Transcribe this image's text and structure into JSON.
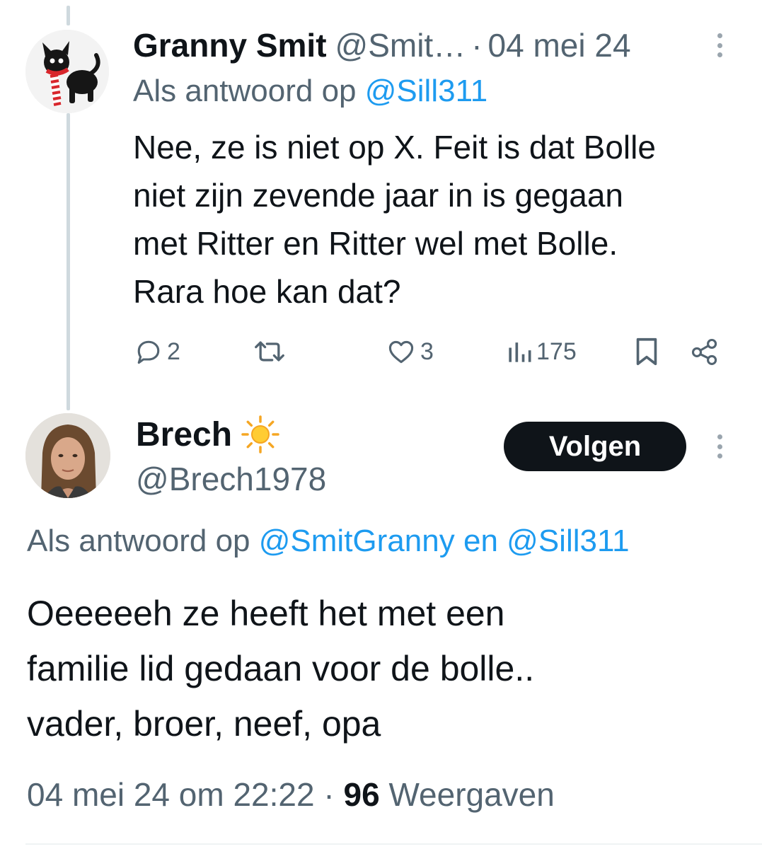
{
  "tweet1": {
    "display_name": "Granny Smit",
    "handle": "@Smit…",
    "separator": "·",
    "date": "04 mei 24",
    "reply_prefix": "Als antwoord op",
    "reply_mention": "@Sill311",
    "body_lines": [
      "Nee, ze is niet op X. Feit is dat Bolle",
      "niet zijn zevende jaar in is gegaan",
      "met Ritter en Ritter wel met Bolle.",
      "Rara hoe kan dat?"
    ],
    "actions": {
      "replies": "2",
      "retweets": "",
      "likes": "3",
      "views": "175"
    },
    "avatar_icon": "black-cat-with-striped-scarf"
  },
  "tweet2": {
    "display_name": "Brech",
    "name_emoji": "sun-icon",
    "handle": "@Brech1978",
    "follow_label": "Volgen",
    "reply_prefix": "Als antwoord op",
    "reply_mention_1": "@SmitGranny",
    "reply_conjunction": "en",
    "reply_mention_2": "@Sill311",
    "body_lines": [
      "Oeeeeeh ze heeft het met een",
      "familie lid gedaan voor de bolle..",
      "vader, broer, neef, opa"
    ],
    "timestamp": "04 mei 24 om 22:22",
    "separator": "·",
    "views_count": "96",
    "views_label": "Weergaven",
    "avatar_icon": "profile-photo-woman"
  },
  "colors": {
    "text_primary": "#0f1419",
    "text_secondary": "#536471",
    "mention": "#1d9bf0",
    "thread_line": "#cfd9de",
    "button_bg": "#0f1419"
  }
}
